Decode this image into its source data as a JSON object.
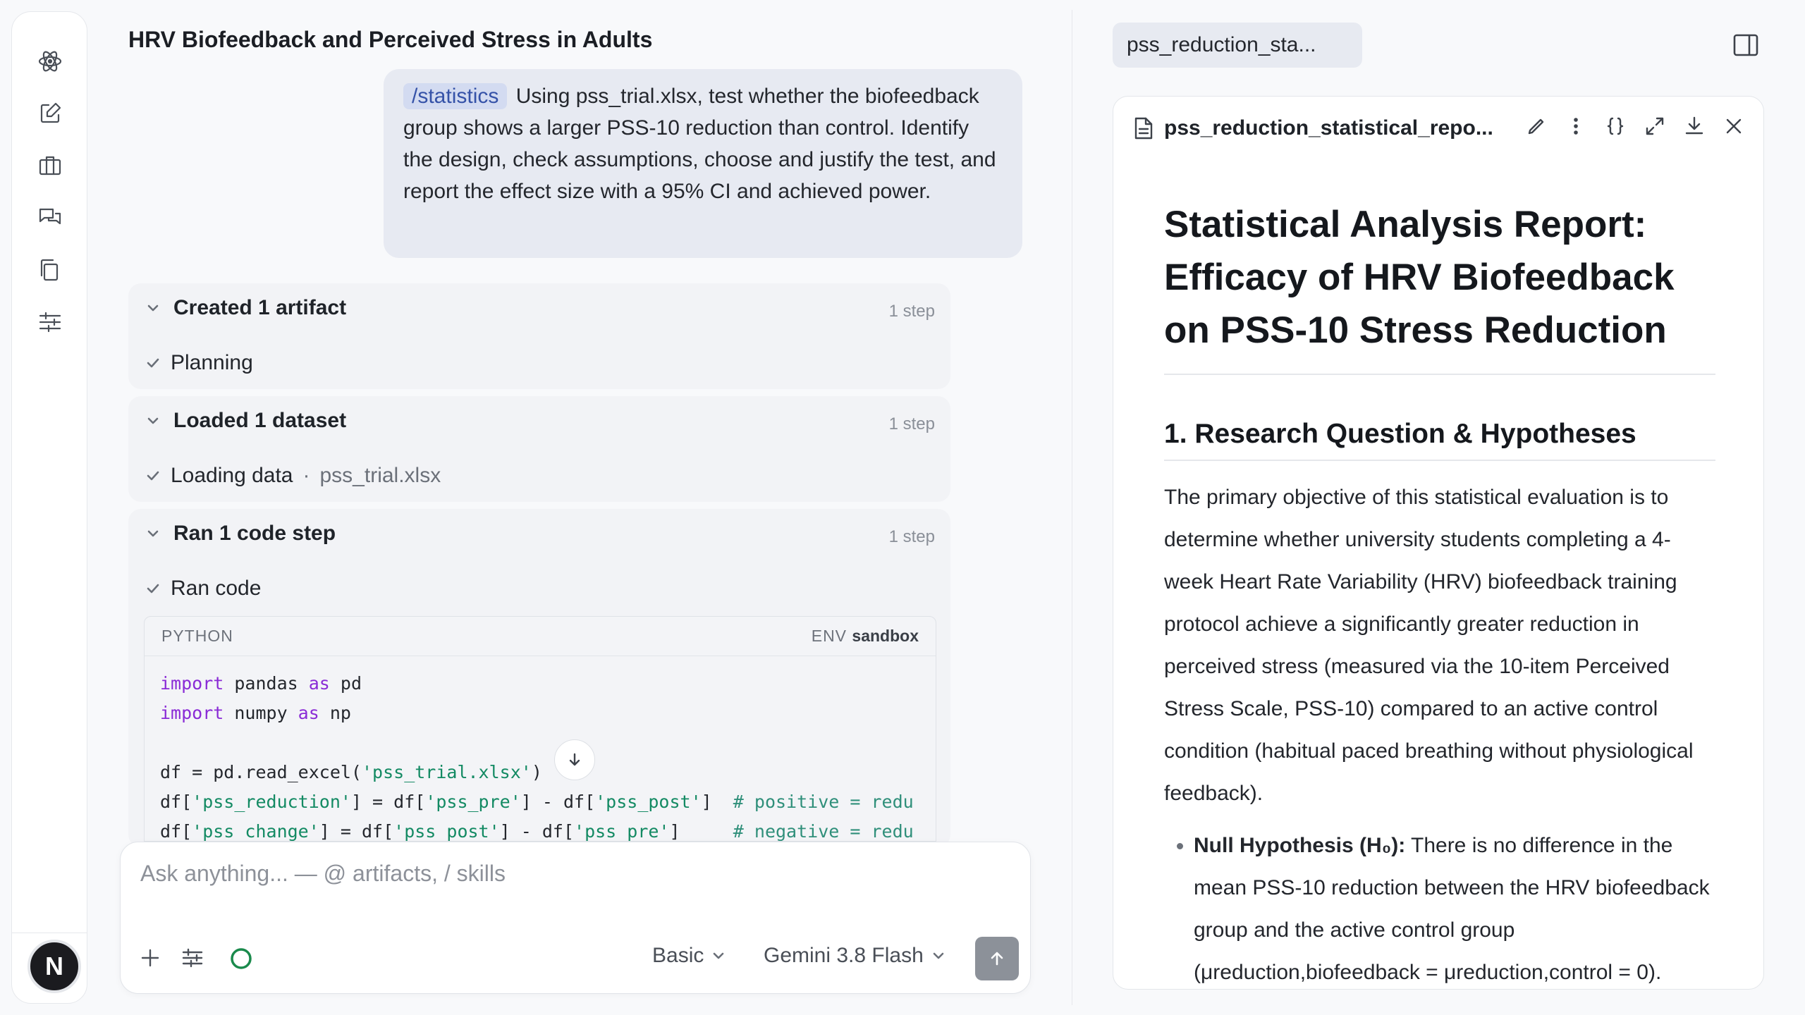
{
  "conversation": {
    "title": "HRV Biofeedback and Perceived Stress in Adults",
    "user_message": {
      "skill": "/statistics",
      "text": "Using pss_trial.xlsx, test whether the biofeedback group shows a larger PSS-10 reduction than control. Identify the design, check assumptions, choose and justify the test, and report the effect size with a 95% CI and achieved power."
    },
    "steps": [
      {
        "header": "Created 1 artifact",
        "count": "1 step",
        "sub": "Planning",
        "detail": ""
      },
      {
        "header": "Loaded 1 dataset",
        "count": "1 step",
        "sub": "Loading data",
        "sep": "·",
        "detail": "pss_trial.xlsx"
      },
      {
        "header": "Ran 1 code step",
        "count": "1 step",
        "sub": "Ran code",
        "detail": ""
      }
    ],
    "code": {
      "language": "PYTHON",
      "env_label": "ENV",
      "env": "sandbox",
      "lines": [
        "import pandas as pd",
        "import numpy as np",
        "",
        "df = pd.read_excel('pss_trial.xlsx')",
        "df['pss_reduction'] = df['pss_pre'] - df['pss_post']  # positive = redu",
        "df['pss_change'] = df['pss_post'] - df['pss_pre']     # negative = redu"
      ]
    }
  },
  "composer": {
    "placeholder": "Ask anything... — @ artifacts, / skills",
    "mode": "Basic",
    "model": "Gemini 3.8 Flash"
  },
  "artifact": {
    "tab_label": "pss_reduction_sta...",
    "file_name": "pss_reduction_statistical_repo...",
    "doc_title": "Statistical Analysis Report: Efficacy of HRV Biofeedback on PSS-10 Stress Reduction",
    "section1_heading": "1. Research Question & Hypotheses",
    "section1_body": "The primary objective of this statistical evaluation is to determine whether university students completing a 4-week Heart Rate Variability (HRV) biofeedback training protocol achieve a significantly greater reduction in perceived stress (measured via the 10-item Perceived Stress Scale, PSS-10) compared to an active control condition (habitual paced breathing without physiological feedback).",
    "h0_label": "Null Hypothesis (H₀):",
    "h0_text": "There is no difference in the mean PSS-10 reduction between the HRV biofeedback group and the active control group (μreduction,biofeedback = μreduction,control = 0)."
  },
  "colors": {
    "accent": "#3552a8",
    "chip_bg": "#d3dbf1",
    "keyword": "#8a2bd6",
    "string": "#138a63",
    "status_ring": "#1a8a4c"
  },
  "icons": {
    "rail": [
      "atom-icon",
      "compose-icon",
      "briefcase-icon",
      "chat-icon",
      "copy-icon",
      "sliders-icon"
    ],
    "avatar_letter": "N"
  }
}
